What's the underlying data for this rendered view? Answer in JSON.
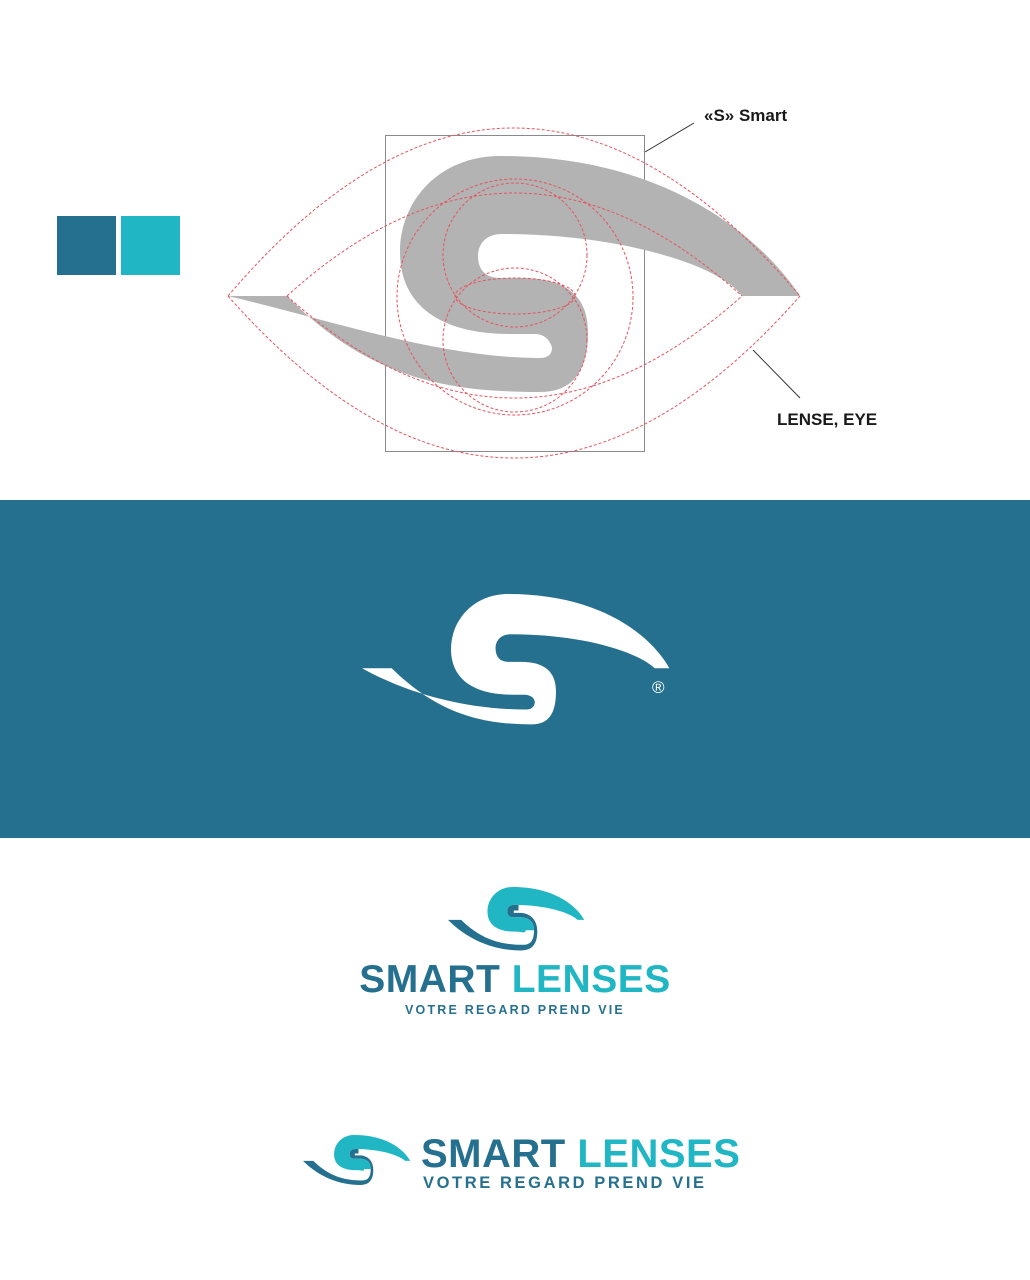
{
  "brand": {
    "name_part_1": "SMART",
    "name_part_2": "LENSES",
    "tagline": "VOTRE REGARD PREND VIE",
    "registered_mark": "®"
  },
  "construction": {
    "callout_s": "«S» Smart",
    "callout_eye": "LENSE, EYE"
  },
  "colors": {
    "primary": "#26708f",
    "secondary": "#20b6c4",
    "construction_fill": "#b3b3b3",
    "guide_line": "#e4545f",
    "band_background": "#26708f",
    "logo_on_band": "#ffffff"
  },
  "icons": {
    "logo_mark": "swirl-eye-s-icon",
    "registered": "registered-trademark-icon"
  }
}
